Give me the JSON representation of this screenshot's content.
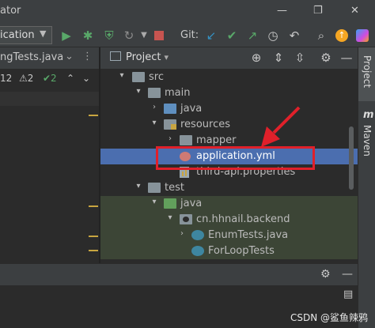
{
  "titlebar": {
    "title": "ator",
    "minimize": "—",
    "restore": "❐",
    "close": "✕"
  },
  "toolbar": {
    "run_config": "ication",
    "run_config_arrow": "▼",
    "git_label": "Git:",
    "icons": [
      "run-icon",
      "debug-icon",
      "coverage-icon",
      "more-run-icon",
      "stop-icon",
      "git-update-icon",
      "git-commit-icon",
      "git-push-icon",
      "history-icon",
      "rollback-icon",
      "search-icon",
      "update-icon",
      "jetbrains-icon"
    ]
  },
  "editor": {
    "tab_label": "ngTests.java",
    "inspection": {
      "warnings": "12",
      "weak_warnings": "⚠2",
      "typos": "✔2"
    }
  },
  "project": {
    "title": "Project",
    "tree": [
      {
        "label": "src",
        "kind": "folder",
        "expanded": true
      },
      {
        "label": "main",
        "kind": "folder",
        "expanded": true
      },
      {
        "label": "java",
        "kind": "source-folder",
        "expanded": false
      },
      {
        "label": "resources",
        "kind": "resources-folder",
        "expanded": true
      },
      {
        "label": "mapper",
        "kind": "folder",
        "expanded": false
      },
      {
        "label": "application.yml",
        "kind": "yaml-file",
        "selected": true
      },
      {
        "label": "third-api.properties",
        "kind": "properties-file"
      },
      {
        "label": "test",
        "kind": "folder",
        "expanded": true
      },
      {
        "label": "java",
        "kind": "test-folder",
        "expanded": true
      },
      {
        "label": "cn.hhnail.backend",
        "kind": "package",
        "expanded": true
      },
      {
        "label": "EnumTests.java",
        "kind": "java-class"
      },
      {
        "label": "ForLoopTests",
        "kind": "java-class"
      }
    ]
  },
  "right_strip": {
    "project_tab": "Project",
    "maven_tab": "Maven",
    "maven_icon": "m"
  },
  "watermark": "CSDN @鲨鱼辣鸦",
  "colors": {
    "selection": "#4b6eaf",
    "test_background": "#3c4536",
    "annotation_red": "#e0202a"
  }
}
